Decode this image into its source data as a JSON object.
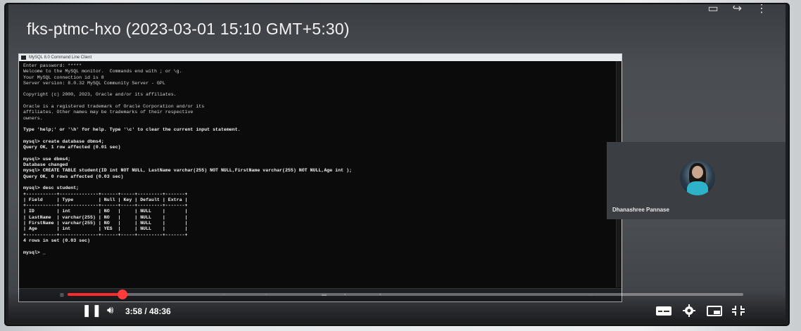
{
  "player": {
    "title": "fks-ptmc-hxo (2023-03-01 15:10 GMT+5:30)",
    "time": "3:58 / 48:36",
    "progress_fraction": 0.0817,
    "accent": "#ff2a2a"
  },
  "terminal": {
    "window_title": "MySQL 8.0 Command Line Client",
    "lines": [
      "Enter password: *****",
      "Welcome to the MySQL monitor.  Commands end with ; or \\g.",
      "Your MySQL connection id is 8",
      "Server version: 8.0.32 MySQL Community Server - GPL",
      "",
      "Copyright (c) 2000, 2023, Oracle and/or its affiliates.",
      "",
      "Oracle is a registered trademark of Oracle Corporation and/or its",
      "affiliates. Other names may be trademarks of their respective",
      "owners.",
      "",
      "Type 'help;' or '\\h' for help. Type '\\c' to clear the current input statement.",
      "",
      "mysql> create database dbms4;",
      "Query OK, 1 row affected (0.01 sec)",
      "",
      "mysql> use dbms4;",
      "Database changed",
      "mysql> CREATE TABLE student(ID int NOT NULL, LastName varchar(255) NOT NULL,FirstName varchar(255) NOT NULL,Age int );",
      "Query OK, 0 rows affected (0.03 sec)",
      "",
      "mysql> desc student;",
      "+-----------+--------------+------+-----+---------+-------+",
      "| Field     | Type         | Null | Key | Default | Extra |",
      "+-----------+--------------+------+-----+---------+-------+",
      "| ID        | int          | NO   |     | NULL    |       |",
      "| LastName  | varchar(255) | NO   |     | NULL    |       |",
      "| FirstName | varchar(255) | NO   |     | NULL    |       |",
      "| Age       | int          | YES  |     | NULL    |       |",
      "+-----------+--------------+------+-----+---------+-------+",
      "4 rows in set (0.03 sec)",
      "",
      "mysql> _"
    ]
  },
  "participant": {
    "name": "Dhanashree Pannase"
  },
  "icons": {
    "play": "play-icon",
    "volume": "volume-icon",
    "subtitles": "subtitles-icon",
    "settings": "gear-icon",
    "miniplayer": "miniplayer-icon",
    "exit_fullscreen": "exit-fullscreen-icon"
  }
}
